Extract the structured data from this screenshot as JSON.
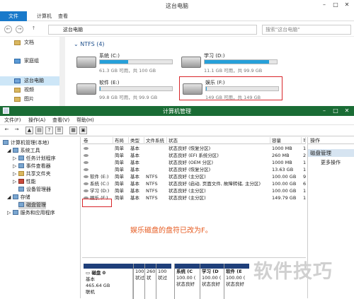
{
  "explorer": {
    "title": "这台电脑",
    "tabs": {
      "file": "文件",
      "computer": "计算机",
      "view": "查看"
    },
    "address": "这台电脑",
    "search_placeholder": "搜索\"这台电脑\"",
    "nav": [
      "文档",
      "家庭组",
      "这台电脑",
      "视频",
      "图片"
    ],
    "section": "NTFS (4)",
    "drives": [
      {
        "name": "系统 (C:)",
        "free": "61.3 GB 可用，共 100 GB",
        "used_fraction": 0.39
      },
      {
        "name": "学习 (D:)",
        "free": "11.1 GB 可用，共 99.9 GB",
        "used_fraction": 0.89
      },
      {
        "name": "软件 (E:)",
        "free": "99.8 GB 可用，共 99.9 GB",
        "used_fraction": 0.01
      },
      {
        "name": "娱乐 (F:)",
        "free": "149 GB 可用，共 149 GB",
        "used_fraction": 0.01
      }
    ]
  },
  "cm": {
    "title": "计算机管理",
    "menu": [
      "文件(F)",
      "操作(A)",
      "查看(V)",
      "帮助(H)"
    ],
    "tree": [
      "计算机管理(本地)",
      "系统工具",
      "任务计划程序",
      "事件查看器",
      "共享文件夹",
      "性能",
      "设备管理器",
      "存储",
      "磁盘管理",
      "服务和应用程序"
    ],
    "columns": [
      "卷",
      "布局",
      "类型",
      "文件系统",
      "状态",
      "容量",
      "可"
    ],
    "rows": [
      {
        "vol": "",
        "layout": "简单",
        "type": "基本",
        "fs": "",
        "status": "状态良好 (恢复分区)",
        "cap": "1000 MB",
        "free": "1"
      },
      {
        "vol": "",
        "layout": "简单",
        "type": "基本",
        "fs": "",
        "status": "状态良好 (EFI 系统分区)",
        "cap": "260 MB",
        "free": "2"
      },
      {
        "vol": "",
        "layout": "简单",
        "type": "基本",
        "fs": "",
        "status": "状态良好 (OEM 分区)",
        "cap": "1000 MB",
        "free": "1"
      },
      {
        "vol": "",
        "layout": "简单",
        "type": "基本",
        "fs": "",
        "status": "状态良好 (恢复分区)",
        "cap": "13.63 GB",
        "free": "1"
      },
      {
        "vol": "软件 (E:)",
        "layout": "简单",
        "type": "基本",
        "fs": "NTFS",
        "status": "状态良好 (主分区)",
        "cap": "100.00 GB",
        "free": "9"
      },
      {
        "vol": "系统 (C:)",
        "layout": "简单",
        "type": "基本",
        "fs": "NTFS",
        "status": "状态良好 (启动, 页面文件, 故障转储, 主分区)",
        "cap": "100.00 GB",
        "free": "6"
      },
      {
        "vol": "学习 (D:)",
        "layout": "简单",
        "type": "基本",
        "fs": "NTFS",
        "status": "状态良好 (主分区)",
        "cap": "100.00 GB",
        "free": "1"
      },
      {
        "vol": "娱乐 (F:)",
        "layout": "简单",
        "type": "基本",
        "fs": "NTFS",
        "status": "状态良好 (主分区)",
        "cap": "149.79 GB",
        "free": "1"
      }
    ],
    "annotation": "娱乐磁盘的盘符已改为F。",
    "disk": {
      "label": "磁盘 0",
      "type": "基本",
      "size": "465.64 GB",
      "state": "联机"
    },
    "parts": [
      {
        "title": "",
        "l2": "100",
        "l3": "状过"
      },
      {
        "title": "",
        "l2": "260",
        "l3": "状"
      },
      {
        "title": "",
        "l2": "100",
        "l3": "状过"
      },
      {
        "title": "系统 (C",
        "l2": "100.00 (",
        "l3": "状态良好"
      },
      {
        "title": "学习 (D",
        "l2": "100.00 (",
        "l3": "状态良好"
      },
      {
        "title": "软件 (E",
        "l2": "100.00 (",
        "l3": "状态良好"
      }
    ],
    "actions": {
      "head": "操作",
      "selected": "磁盘管理",
      "more": "更多操作"
    }
  },
  "watermark": "软件技巧"
}
